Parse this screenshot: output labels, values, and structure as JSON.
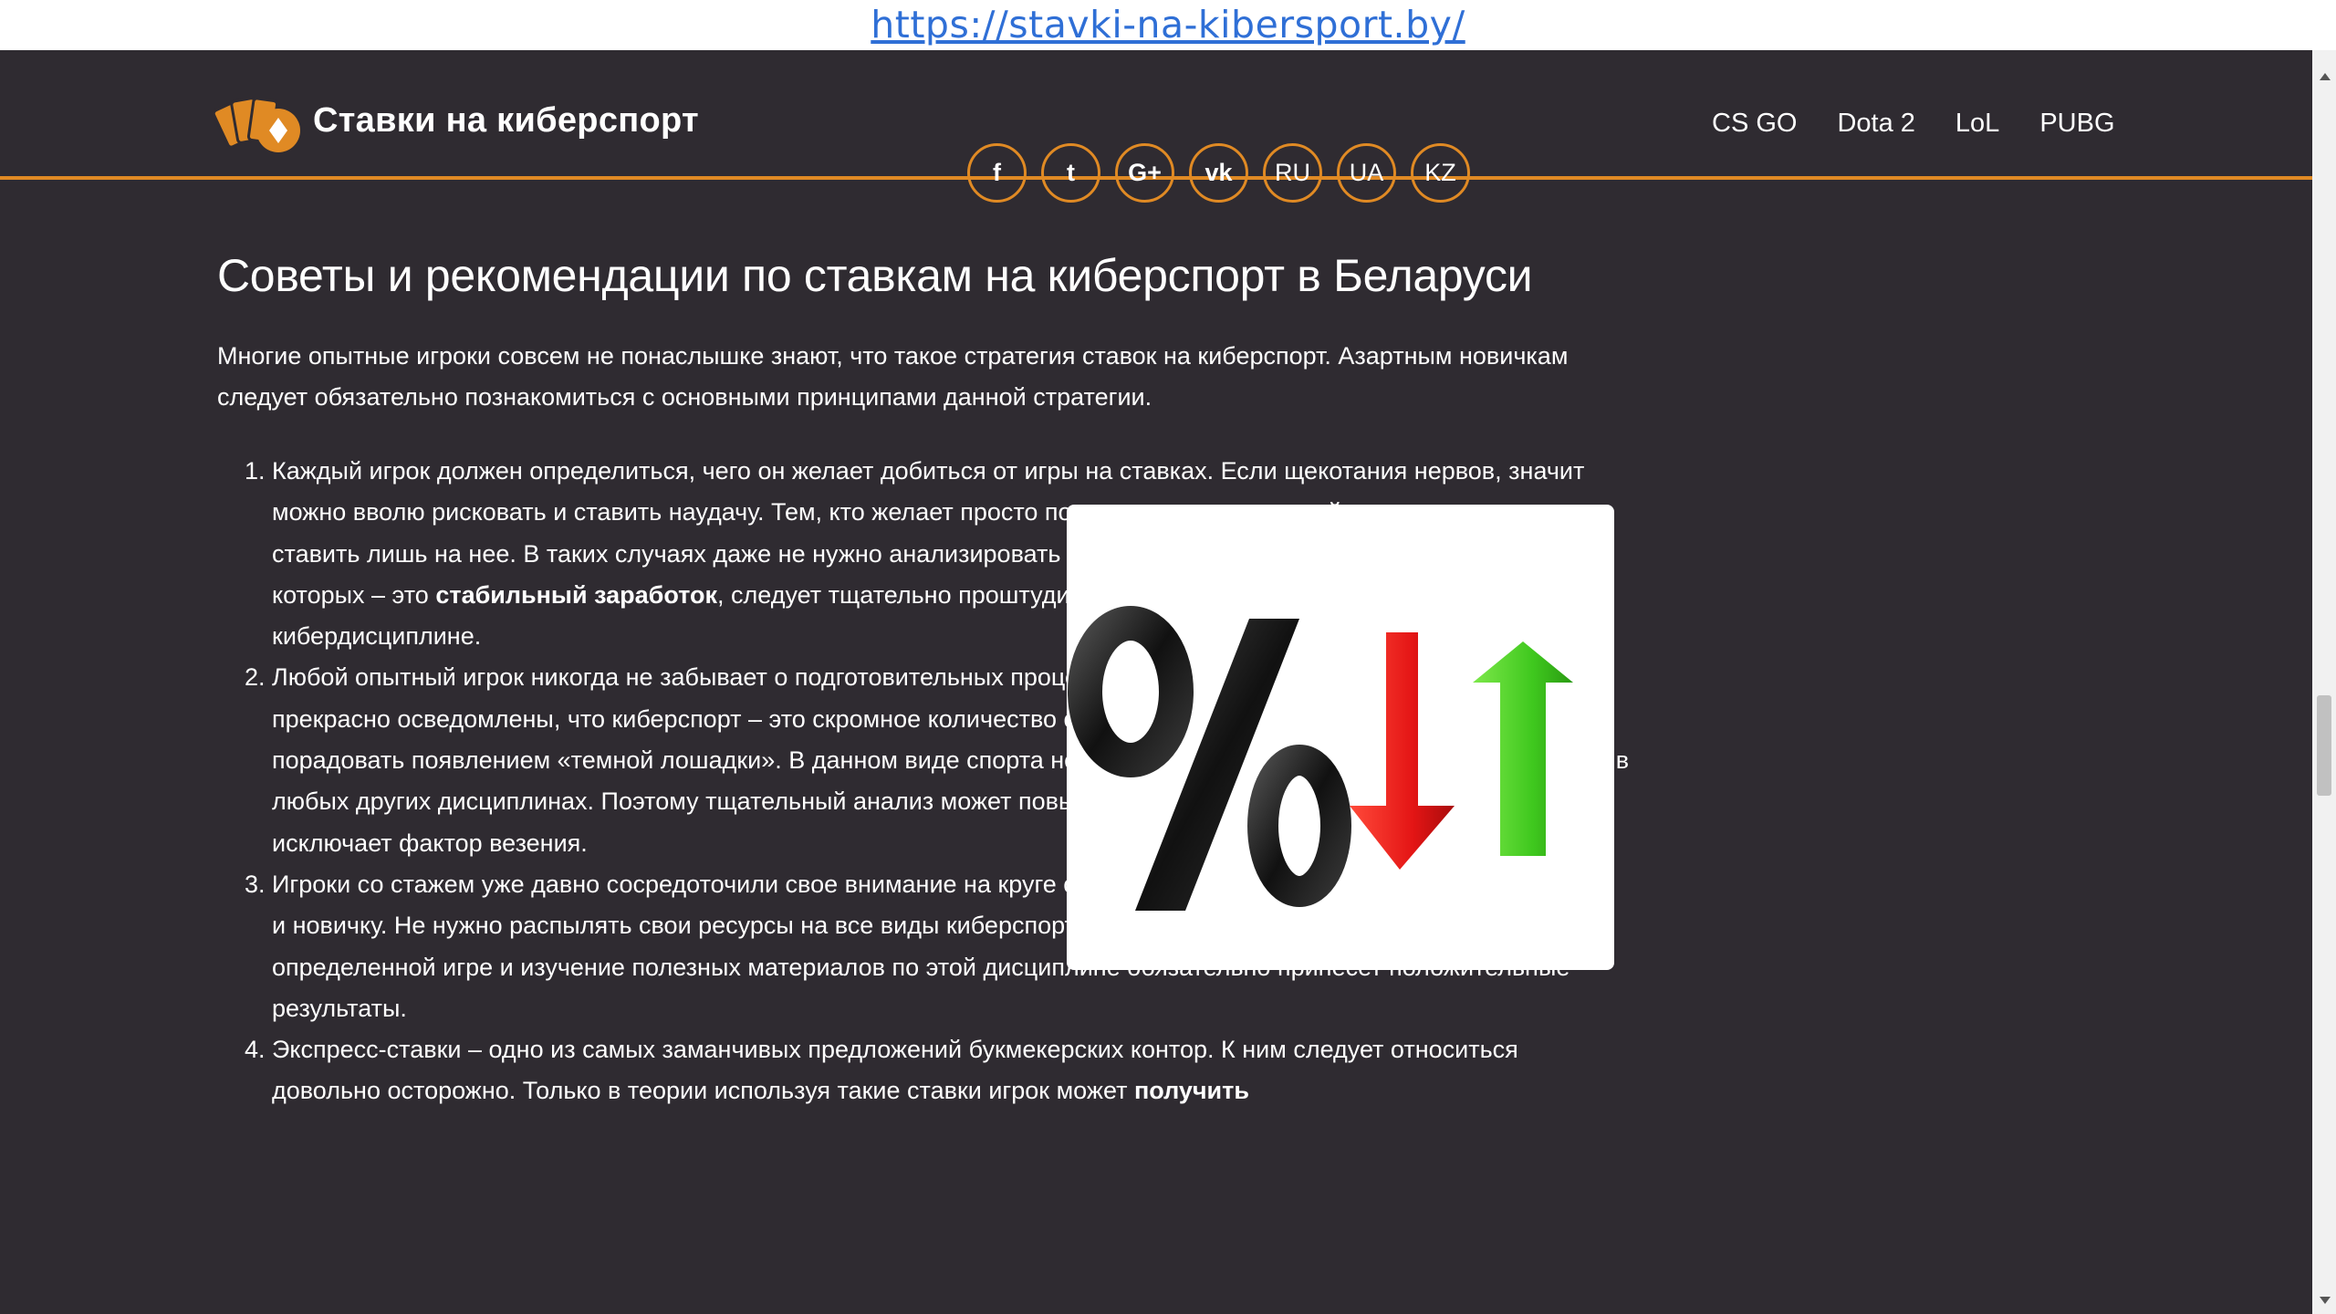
{
  "url": "https://stavki-na-kibersport.by/",
  "header": {
    "site_name": "Ставки на киберспорт",
    "logo_icon": "cards-logo-icon",
    "accent_color": "#e08a24",
    "social": [
      {
        "name": "facebook",
        "icon": "facebook-icon",
        "glyph": "f"
      },
      {
        "name": "twitter",
        "icon": "twitter-icon",
        "glyph": "t"
      },
      {
        "name": "google-plus",
        "icon": "google-plus-icon",
        "glyph": "G+"
      },
      {
        "name": "vk",
        "icon": "vk-icon",
        "glyph": "vk"
      }
    ],
    "languages": [
      "RU",
      "UA",
      "KZ"
    ],
    "nav": [
      "CS GO",
      "Dota 2",
      "LoL",
      "PUBG"
    ]
  },
  "article": {
    "heading": "Советы и рекомендации по ставкам на киберспорт в Беларуси",
    "intro": "Многие опытные игроки совсем не понаслышке знают, что такое стратегия ставок на киберспорт. Азартным новичкам следует обязательно познакомиться с основными принципами данной стратегии.",
    "image_icon": "percent-arrows-image",
    "items": [
      {
        "before": "Каждый игрок должен определиться, чего он желает добиться от игры на ставках. Если щекотания нервов, значит можно вволю рисковать и ставить наудачу. Тем, кто желает просто поддержать дух знакомой команды следует ставить лишь на нее. В таких случаях даже не нужно анализировать шансы противника. Игрокам, основная цель которых – это ",
        "bold": "стабильный заработок",
        "after": ", следует тщательно проштудировать материалы по выбранной кибердисциплине."
      },
      {
        "before": "Любой опытный игрок никогда не забывает о подготовительных процессах и анализе. Асы азартных развлечений прекрасно осведомлены, что киберспорт – это скромное количество однозначных лидеров. Он всегда может порадовать появлением «темной лошадки». В данном виде спорта неизвестные спортсмены появляются чаще, чем в любых других дисциплинах. Поэтому тщательный анализ может повысить шансы успешности ставки. Однако он не исключает фактор везения.",
        "bold": "",
        "after": ""
      },
      {
        "before": "Игроки со стажем уже давно сосредоточили свое внимание на круге определенных дисциплин. Это следует сделать и новичку. Не нужно распылять свои ресурсы на все виды киберспортивных состязаний. Концентрация на определенной игре и изучение полезных материалов по этой дисциплине обязательно принесет положительные результаты.",
        "bold": "",
        "after": ""
      },
      {
        "before": "Экспресс-ставки – одно из самых заманчивых предложений букмекерских контор. К ним следует относиться довольно осторожно. Только в теории используя такие ставки игрок может ",
        "bold": "получить",
        "after": ""
      }
    ]
  }
}
